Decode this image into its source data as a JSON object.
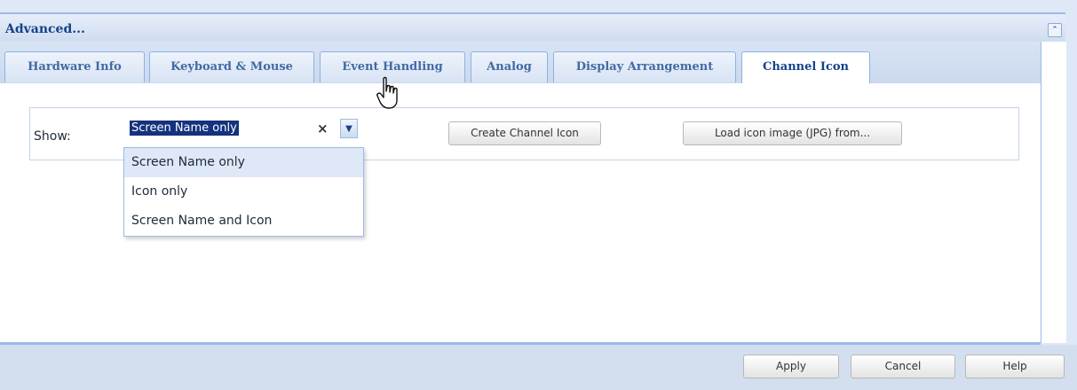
{
  "window": {
    "title": "Advanced...",
    "collapse_icon": "double-chevron-up-icon"
  },
  "tabs": [
    {
      "label": "Hardware Info",
      "active": false
    },
    {
      "label": "Keyboard & Mouse",
      "active": false
    },
    {
      "label": "Event Handling",
      "active": false
    },
    {
      "label": "Analog",
      "active": false
    },
    {
      "label": "Display Arrangement",
      "active": false
    },
    {
      "label": "Channel Icon",
      "active": true
    }
  ],
  "show": {
    "label": "Show:",
    "selected_value": "Screen Name only",
    "clear_glyph": "×",
    "options": [
      "Screen Name only",
      "Icon only",
      "Screen Name and Icon"
    ]
  },
  "buttons": {
    "create_icon": "Create Channel Icon",
    "load_icon": "Load icon image (JPG) from..."
  },
  "footer": {
    "apply": "Apply",
    "cancel": "Cancel",
    "help": "Help"
  },
  "colors": {
    "accent": "#15428b",
    "border": "#99bbe8",
    "selection": "#15327e"
  }
}
